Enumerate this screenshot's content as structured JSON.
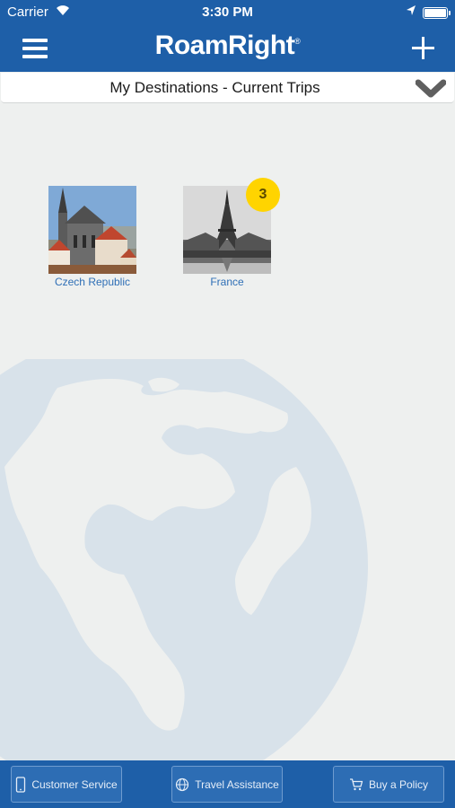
{
  "status_bar": {
    "carrier": "Carrier",
    "time": "3:30 PM"
  },
  "nav": {
    "logo": "RoamRight",
    "logo_mark": "®",
    "menu_icon": "hamburger-menu-icon",
    "add_icon": "plus-icon"
  },
  "dropdown": {
    "label": "My Destinations - Current Trips",
    "icon": "chevron-down-icon"
  },
  "destinations": [
    {
      "name": "Czech Republic",
      "image": "church-photo"
    },
    {
      "name": "France",
      "image": "eiffel-tower-photo",
      "badge": "3"
    }
  ],
  "toolbar": {
    "customer_service": "Customer Service",
    "travel_assistance": "Travel Assistance",
    "buy_policy": "Buy a Policy"
  },
  "colors": {
    "brand_blue": "#1e5fa8",
    "badge_yellow": "#ffd400",
    "link_blue": "#2f6fb6",
    "globe": "#d4dfe8"
  }
}
